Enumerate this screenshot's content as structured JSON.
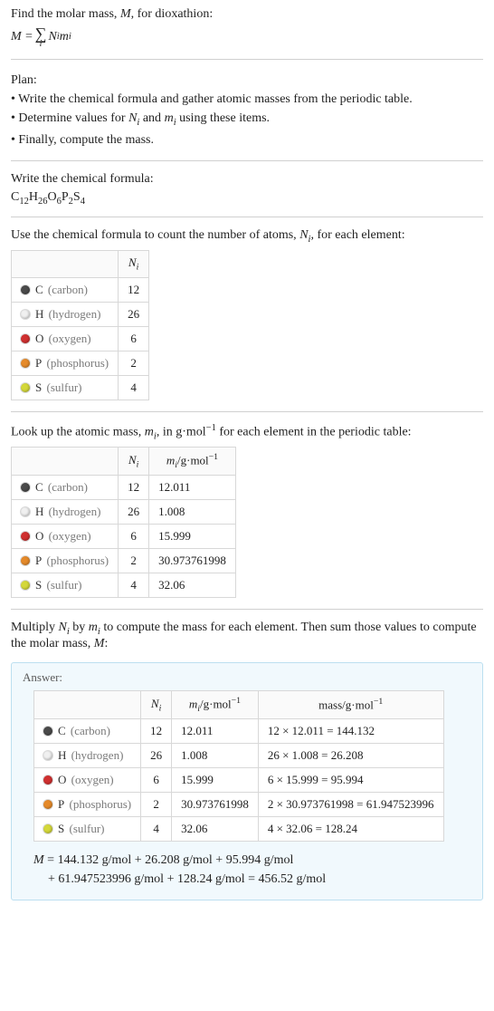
{
  "intro": {
    "line1_a": "Find the molar mass, ",
    "line1_m": "M",
    "line1_b": ", for dioxathion:",
    "eq_lhs": "M = ",
    "eq_sigma_sub": "i",
    "eq_rhs_a": " N",
    "eq_rhs_sub1": "i",
    "eq_rhs_b": "m",
    "eq_rhs_sub2": "i"
  },
  "plan": {
    "heading": "Plan:",
    "l1a": "• Write the chemical formula and gather atomic masses from the periodic table.",
    "l2a": "• Determine values for ",
    "l2n": "N",
    "l2s1": "i",
    "l2b": " and ",
    "l2m": "m",
    "l2s2": "i",
    "l2c": " using these items.",
    "l3a": "• Finally, compute the mass."
  },
  "chem": {
    "heading": "Write the chemical formula:",
    "prefix": "C",
    "s1": "12",
    "t2": "H",
    "s2": "26",
    "t3": "O",
    "s3": "6",
    "t4": "P",
    "s4": "2",
    "t5": "S",
    "s5": "4"
  },
  "count": {
    "heading_a": "Use the chemical formula to count the number of atoms, ",
    "heading_n": "N",
    "heading_s": "i",
    "heading_b": ", for each element:",
    "col_n": "N",
    "col_n_sub": "i"
  },
  "elements": [
    {
      "color": "#4a4a4a",
      "sym": "C",
      "name": "(carbon)",
      "N": "12",
      "m": "12.011",
      "mass": "12 × 12.011 = 144.132"
    },
    {
      "color": "#f0f0f0",
      "sym": "H",
      "name": "(hydrogen)",
      "N": "26",
      "m": "1.008",
      "mass": "26 × 1.008 = 26.208"
    },
    {
      "color": "#d03030",
      "sym": "O",
      "name": "(oxygen)",
      "N": "6",
      "m": "15.999",
      "mass": "6 × 15.999 = 95.994"
    },
    {
      "color": "#e58a2a",
      "sym": "P",
      "name": "(phosphorus)",
      "N": "2",
      "m": "30.973761998",
      "mass": "2 × 30.973761998 = 61.947523996"
    },
    {
      "color": "#d4d83a",
      "sym": "S",
      "name": "(sulfur)",
      "N": "4",
      "m": "32.06",
      "mass": "4 × 32.06 = 128.24"
    }
  ],
  "lookup": {
    "heading_a": "Look up the atomic mass, ",
    "heading_m": "m",
    "heading_s": "i",
    "heading_b": ", in g·mol",
    "heading_exp": "−1",
    "heading_c": " for each element in the periodic table:",
    "col_m_a": "m",
    "col_m_s": "i",
    "col_m_b": "/g·mol",
    "col_m_exp": "−1"
  },
  "multiply": {
    "text_a": "Multiply ",
    "n": "N",
    "s1": "i",
    "text_b": " by ",
    "m": "m",
    "s2": "i",
    "text_c": " to compute the mass for each element. Then sum those values to compute the molar mass, ",
    "mm": "M",
    "text_d": ":"
  },
  "answer": {
    "label": "Answer:",
    "mass_col_a": "mass/g·mol",
    "mass_col_exp": "−1",
    "final_l1": "M = 144.132 g/mol + 26.208 g/mol + 95.994 g/mol",
    "final_l2": "+ 61.947523996 g/mol + 128.24 g/mol = 456.52 g/mol"
  },
  "chart_data": {
    "type": "table",
    "title": "Molar mass computation for dioxathion C12H26O6P2S4",
    "categories": [
      "C (carbon)",
      "H (hydrogen)",
      "O (oxygen)",
      "P (phosphorus)",
      "S (sulfur)"
    ],
    "series": [
      {
        "name": "N_i",
        "values": [
          12,
          26,
          6,
          2,
          4
        ]
      },
      {
        "name": "m_i / g·mol^-1",
        "values": [
          12.011,
          1.008,
          15.999,
          30.973761998,
          32.06
        ]
      },
      {
        "name": "mass / g·mol^-1",
        "values": [
          144.132,
          26.208,
          95.994,
          61.947523996,
          128.24
        ]
      }
    ],
    "total_molar_mass_g_per_mol": 456.52
  }
}
